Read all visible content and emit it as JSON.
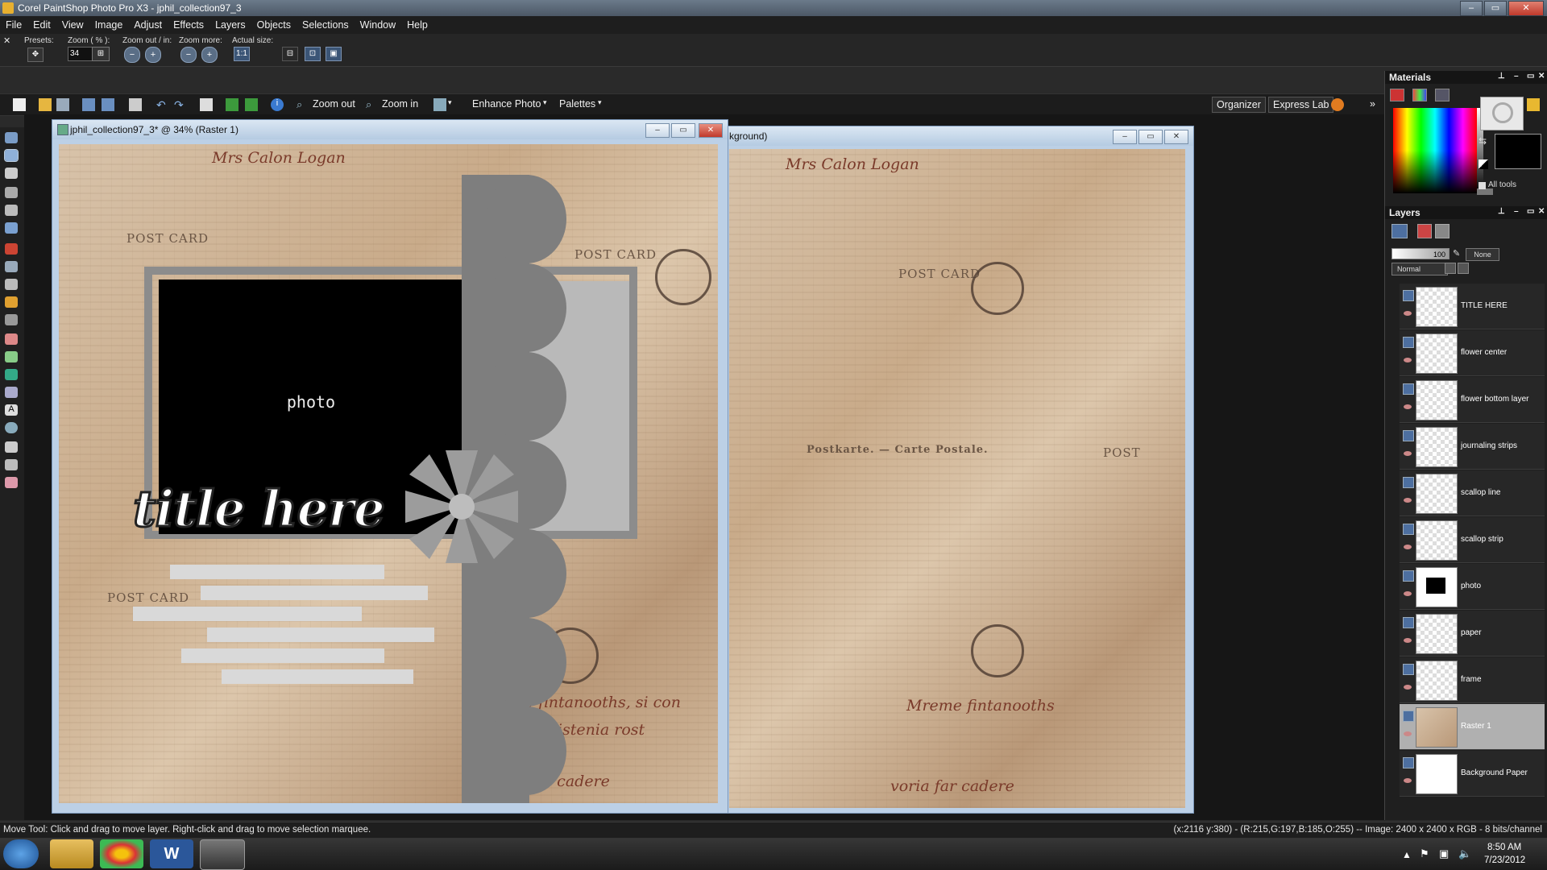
{
  "window": {
    "title": "Corel PaintShop Photo Pro X3 - jphil_collection97_3"
  },
  "menu": [
    "File",
    "Edit",
    "View",
    "Image",
    "Adjust",
    "Effects",
    "Layers",
    "Objects",
    "Selections",
    "Window",
    "Help"
  ],
  "options": {
    "presets_label": "Presets:",
    "zoom_label": "Zoom ( % ):",
    "zoom_value": "34",
    "zoom_inout_label": "Zoom out / in:",
    "zoom_more_label": "Zoom more:",
    "actual_size_label": "Actual size:"
  },
  "toolbar": {
    "zoom_out": "Zoom out",
    "zoom_in": "Zoom in",
    "enhance_photo": "Enhance Photo",
    "palettes": "Palettes",
    "organizer": "Organizer",
    "express_lab": "Express Lab"
  },
  "doc1": {
    "title": "jphil_collection97_3* @  34% (Raster 1)",
    "photo_label": "photo",
    "title_art": "title here"
  },
  "doc2": {
    "title_fragment": "kground)"
  },
  "materials": {
    "title": "Materials",
    "all_tools": "All tools"
  },
  "layers_palette": {
    "title": "Layers",
    "opacity": "100",
    "blend_mode": "Normal",
    "mask_mode": "None",
    "layers": [
      {
        "name": "TITLE HERE"
      },
      {
        "name": "flower center"
      },
      {
        "name": "flower bottom layer"
      },
      {
        "name": "journaling strips"
      },
      {
        "name": "scallop line"
      },
      {
        "name": "scallop strip"
      },
      {
        "name": "photo"
      },
      {
        "name": "paper"
      },
      {
        "name": "frame"
      },
      {
        "name": "Raster 1"
      },
      {
        "name": "Background Paper"
      }
    ]
  },
  "statusbar": {
    "hint": "Move Tool: Click and drag to move layer. Right-click and drag to move selection marquee.",
    "info": "(x:2116 y:380) - (R:215,G:197,B:185,O:255) -- Image:  2400 x 2400 x RGB - 8 bits/channel"
  },
  "taskbar": {
    "time": "8:50 AM",
    "date": "7/23/2012"
  }
}
